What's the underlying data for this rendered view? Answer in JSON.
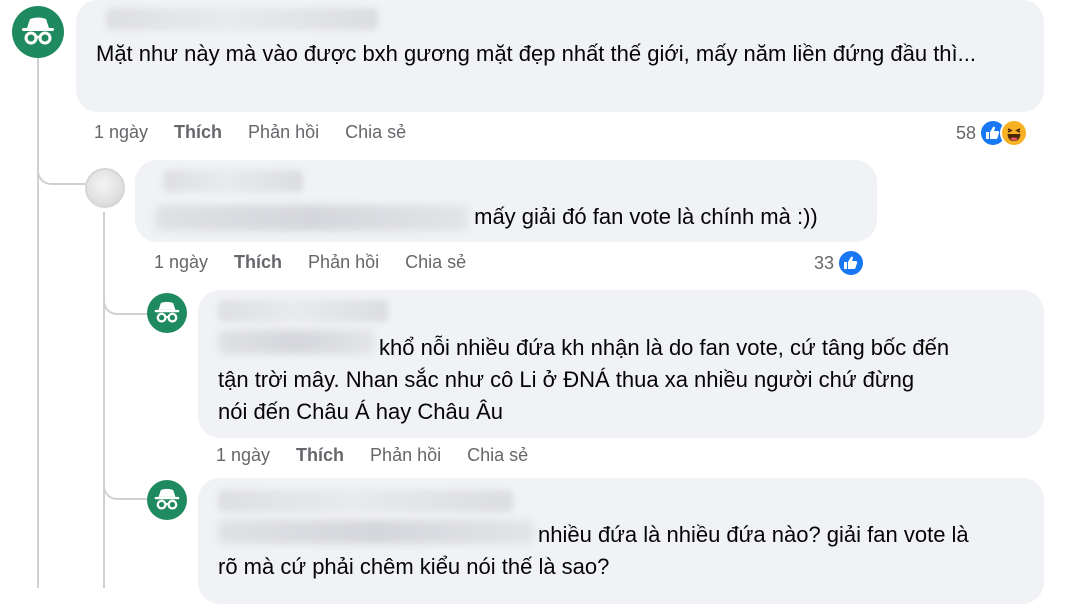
{
  "comments": [
    {
      "text": "Mặt như này mà vào được bxh gương mặt đẹp nhất thế giới, mấy năm liền đứng đầu thì...",
      "time": "1 ngày",
      "like_label": "Thích",
      "reply_label": "Phản hồi",
      "share_label": "Chia sẻ",
      "reaction_count": "58",
      "reactions": [
        "like-icon",
        "haha-icon"
      ]
    },
    {
      "text": "mấy giải đó fan vote là chính mà :))",
      "time": "1 ngày",
      "like_label": "Thích",
      "reply_label": "Phản hồi",
      "share_label": "Chia sẻ",
      "reaction_count": "33",
      "reactions": [
        "like-icon"
      ]
    },
    {
      "text_lines": [
        "khổ nỗi nhiều đứa kh nhận là do fan vote, cứ tâng bốc đến",
        "tận trời mây. Nhan sắc như cô Li ở ĐNÁ thua xa nhiều người chứ đừng",
        "nói đến Châu Á hay Châu Âu"
      ],
      "time": "1 ngày",
      "like_label": "Thích",
      "reply_label": "Phản hồi",
      "share_label": "Chia sẻ"
    },
    {
      "text_lines": [
        "nhiều đứa là nhiều đứa nào? giải fan vote là",
        "rõ mà cứ phải chêm kiểu nói thế là sao?"
      ]
    }
  ],
  "colors": {
    "bubble": "#f0f2f5",
    "action_text": "#65676b",
    "like_blue": "#1877f2",
    "avatar_green": "#1f8a5f"
  }
}
